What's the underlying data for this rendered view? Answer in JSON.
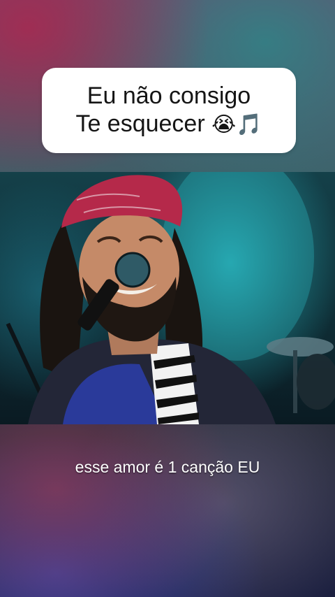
{
  "title": {
    "line1": "Eu não consigo",
    "line2": "Te esquecer",
    "emoji_crying": "😭",
    "emoji_music": "🎵"
  },
  "caption": {
    "text": "esse amor é 1 canção EU"
  },
  "colors": {
    "card_background": "#ffffff",
    "title_text": "#151515",
    "caption_text": "#ffffff",
    "bandana": "#b5294a",
    "stage_light": "#2bb4be"
  },
  "video": {
    "subject": "singer-with-microphone-on-stage"
  }
}
